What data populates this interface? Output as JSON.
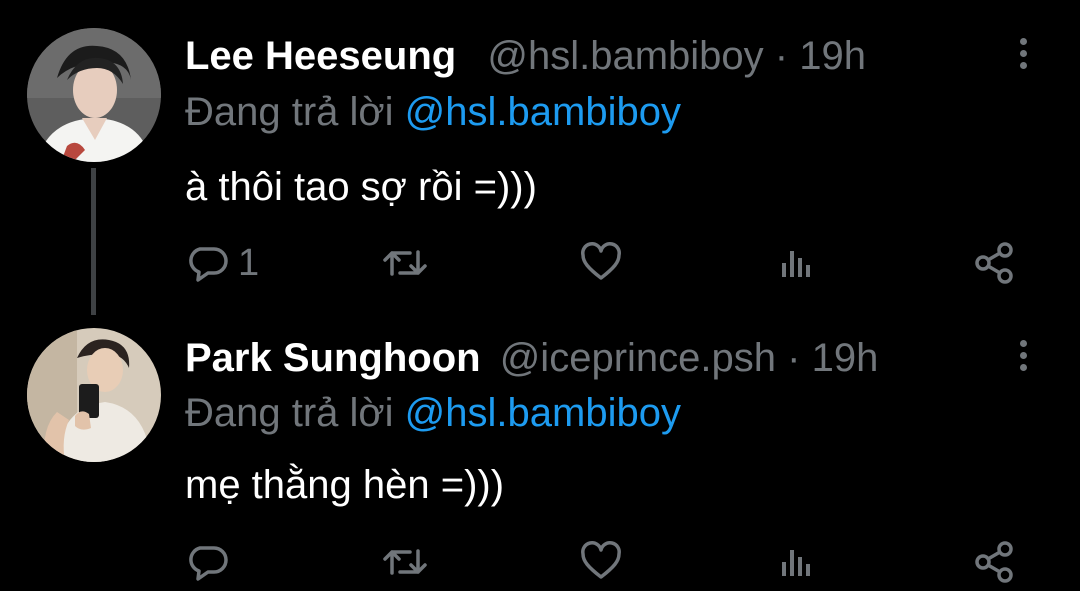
{
  "colors": {
    "background": "#000000",
    "primary_text": "#ffffff",
    "secondary_text": "#71767b",
    "mention": "#1d9bf0",
    "thread_line": "#3e4144"
  },
  "tweets": [
    {
      "display_name": "Lee Heeseung",
      "handle": "@hsl.bambiboy",
      "separator": "·",
      "time": "19h",
      "reply_prefix": "Đang trả lời",
      "reply_to": "@hsl.bambiboy",
      "text": "à thôi tao sợ rồi =)))",
      "reply_count": "1",
      "icons": [
        "reply-icon",
        "retweet-icon",
        "like-icon",
        "views-icon",
        "share-icon",
        "more-icon"
      ]
    },
    {
      "display_name": "Park Sunghoon",
      "handle": "@iceprince.psh",
      "separator": "·",
      "time": "19h",
      "reply_prefix": "Đang trả lời",
      "reply_to": "@hsl.bambiboy",
      "text": "mẹ thằng hèn =)))",
      "reply_count": "",
      "icons": [
        "reply-icon",
        "retweet-icon",
        "like-icon",
        "views-icon",
        "share-icon",
        "more-icon"
      ]
    }
  ]
}
